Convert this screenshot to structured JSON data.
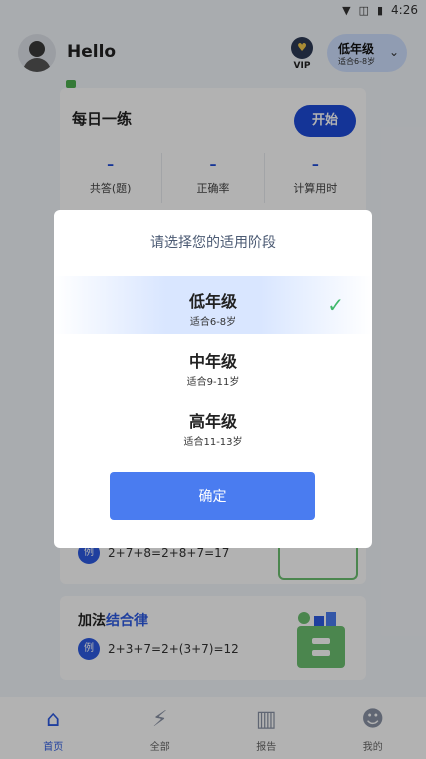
{
  "status_bar": {
    "time": "4:26"
  },
  "header": {
    "greeting": "Hello",
    "vip_label": "VIP",
    "grade_name": "低年级",
    "grade_ages": "适合6-8岁"
  },
  "daily_card": {
    "title": "每日一练",
    "start_label": "开始",
    "stats": [
      {
        "value": "–",
        "label": "共答(题)"
      },
      {
        "value": "–",
        "label": "正确率"
      },
      {
        "value": "–",
        "label": "计算用时"
      }
    ]
  },
  "rules": [
    {
      "badge": "例",
      "formula": "2+7+8=2+8+7=17"
    },
    {
      "title_prefix": "加法",
      "title_accent": "结合律",
      "badge": "例",
      "formula": "2+3+7=2+(3+7)=12"
    }
  ],
  "tabs": [
    {
      "label": "首页",
      "icon": "home-icon",
      "active": true
    },
    {
      "label": "全部",
      "icon": "lightning-icon",
      "active": false
    },
    {
      "label": "报告",
      "icon": "chart-icon",
      "active": false
    },
    {
      "label": "我的",
      "icon": "person-icon",
      "active": false
    }
  ],
  "dialog": {
    "title": "请选择您的适用阶段",
    "options": [
      {
        "name": "低年级",
        "ages": "适合6-8岁",
        "selected": true
      },
      {
        "name": "中年级",
        "ages": "适合9-11岁",
        "selected": false
      },
      {
        "name": "高年级",
        "ages": "适合11-13岁",
        "selected": false
      }
    ],
    "confirm_label": "确定"
  },
  "colors": {
    "accent": "#4a7cf0",
    "primary_dark": "#1e4bd8",
    "check": "#3fb86b"
  }
}
